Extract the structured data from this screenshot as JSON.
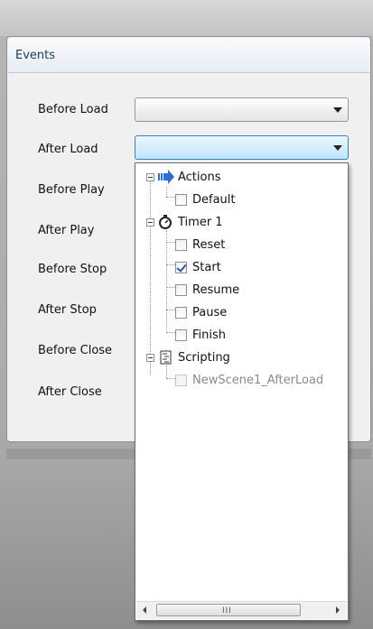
{
  "panel": {
    "title": "Events"
  },
  "events": [
    {
      "label": "Before Load"
    },
    {
      "label": "After Load"
    },
    {
      "label": "Before Play"
    },
    {
      "label": "After Play"
    },
    {
      "label": "Before Stop"
    },
    {
      "label": "After Stop"
    },
    {
      "label": "Before Close"
    },
    {
      "label": "After Close"
    }
  ],
  "dropdown": {
    "tree": [
      {
        "label": "Actions",
        "icon": "arrow-right-icon",
        "expanded": true,
        "children": [
          {
            "label": "Default",
            "checked": false,
            "enabled": true
          }
        ]
      },
      {
        "label": "Timer 1",
        "icon": "stopwatch-icon",
        "expanded": true,
        "children": [
          {
            "label": "Reset",
            "checked": false,
            "enabled": true
          },
          {
            "label": "Start",
            "checked": true,
            "enabled": true
          },
          {
            "label": "Resume",
            "checked": false,
            "enabled": true
          },
          {
            "label": "Pause",
            "checked": false,
            "enabled": true
          },
          {
            "label": "Finish",
            "checked": false,
            "enabled": true
          }
        ]
      },
      {
        "label": "Scripting",
        "icon": "script-icon",
        "expanded": true,
        "children": [
          {
            "label": "NewScene1_AfterLoad",
            "checked": false,
            "enabled": false
          }
        ]
      }
    ],
    "scrollbar": {
      "grip": "III"
    }
  },
  "colors": {
    "accent": "#3c7fb1",
    "arrow": "#2b6fd6",
    "check": "#2a55a8"
  }
}
